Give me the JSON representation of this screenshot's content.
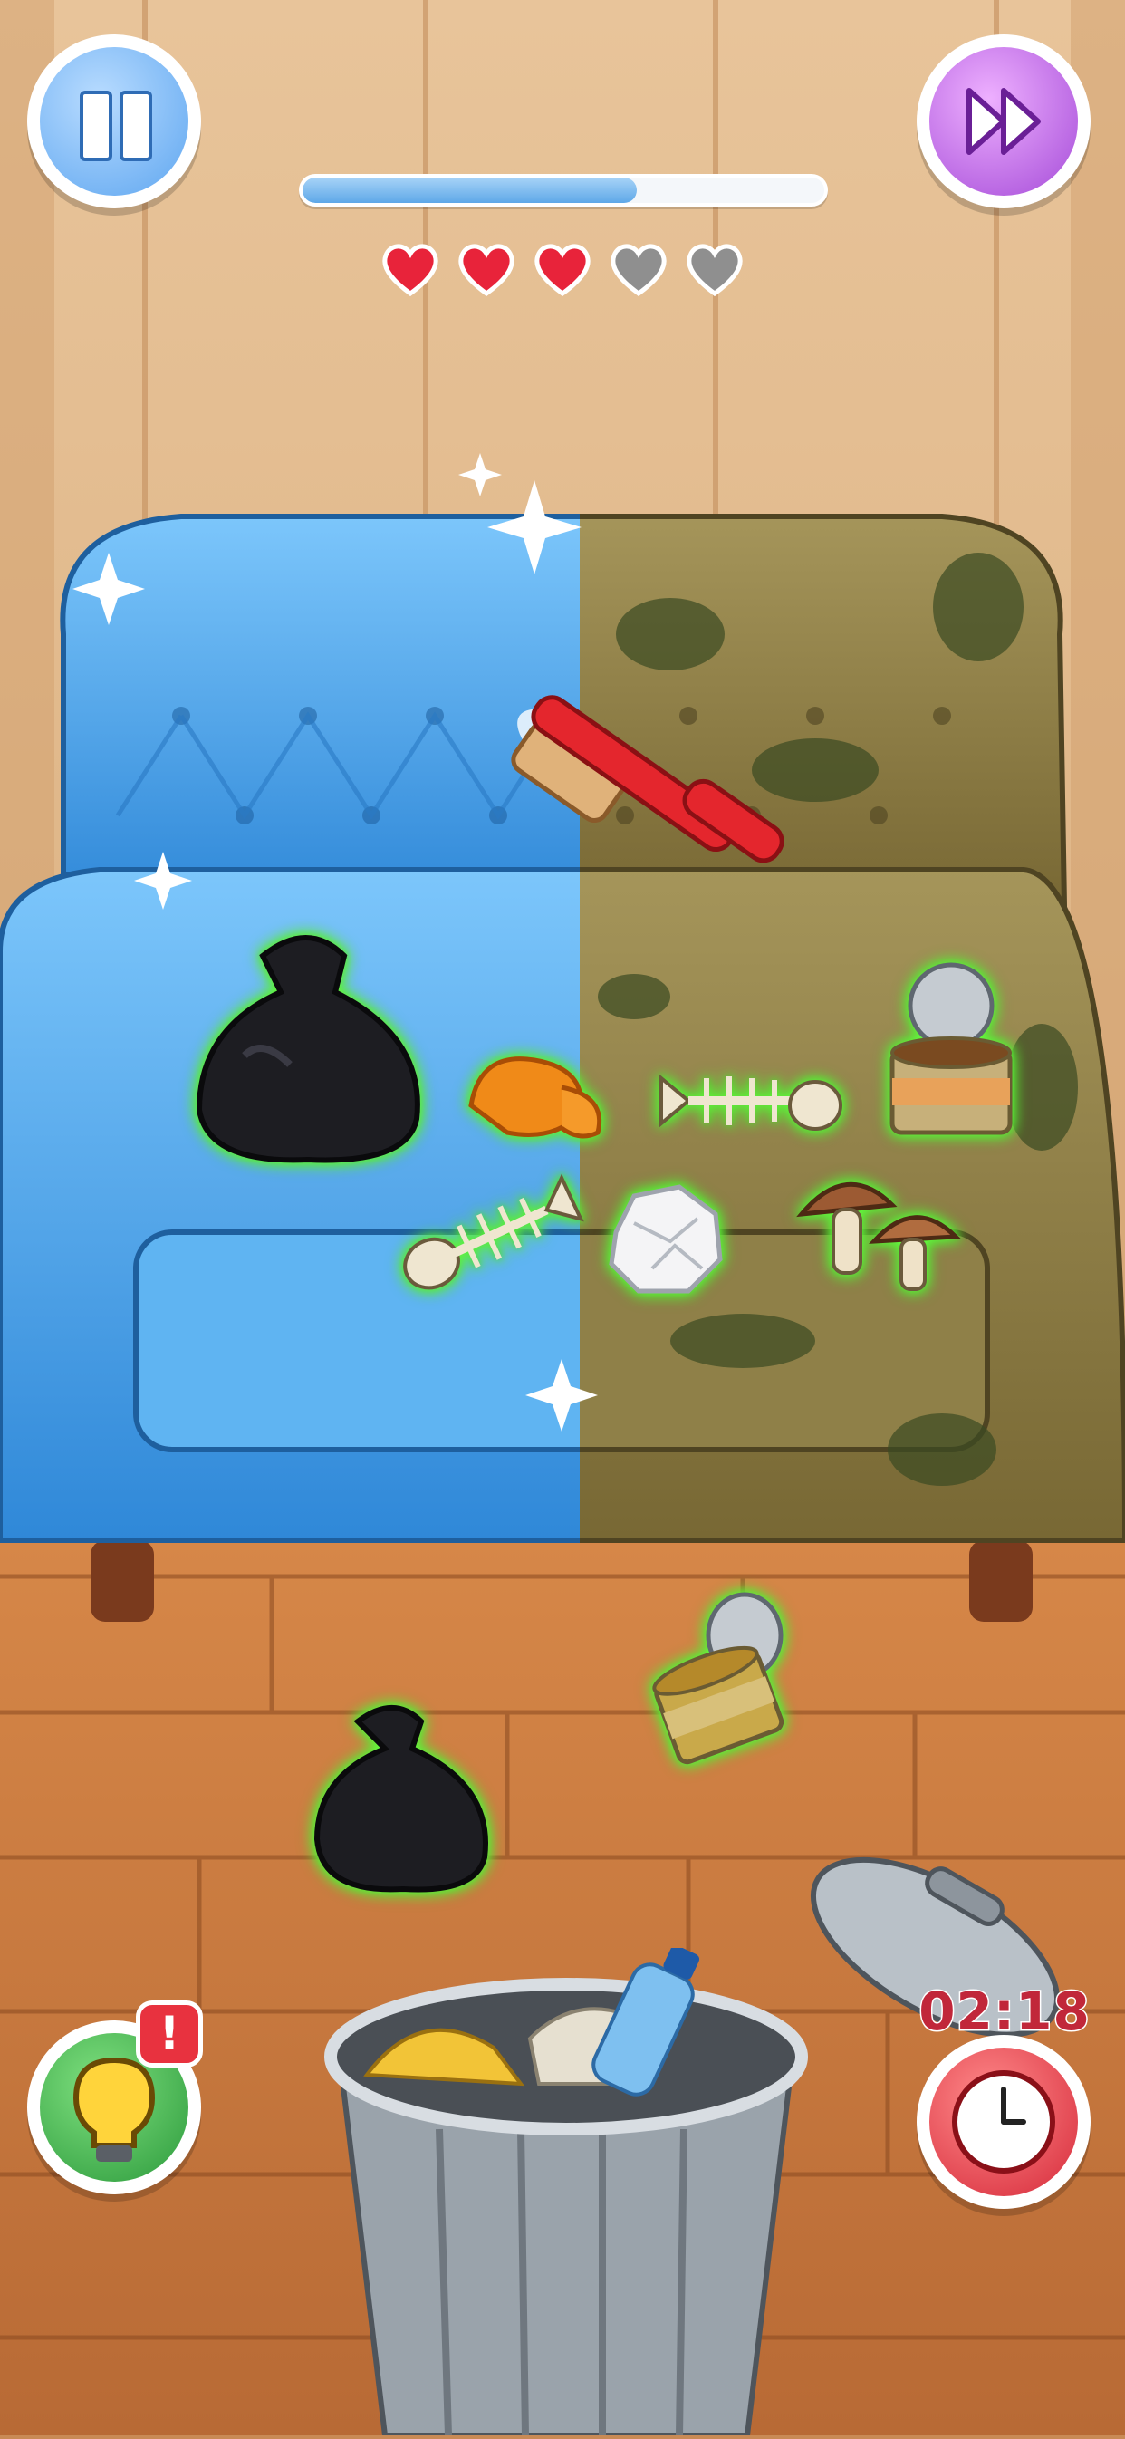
{
  "hud": {
    "pause_icon": "pause-icon",
    "skip_icon": "fast-forward-icon",
    "progress_fraction": 0.64,
    "hearts": [
      {
        "state": "full"
      },
      {
        "state": "full"
      },
      {
        "state": "full"
      },
      {
        "state": "empty"
      },
      {
        "state": "empty"
      }
    ],
    "hint_icon": "lightbulb-icon",
    "hint_badge": "!",
    "timer": "02:18",
    "timer_icon": "clock-icon"
  },
  "colors": {
    "heart_full": "#e8233a",
    "heart_empty": "#8f8f8f",
    "clean_sofa": "#4aa8ee",
    "dirty_sofa": "#8a7a3c",
    "item_glow": "#5dff3a",
    "timer_text": "#c1273a"
  },
  "items": [
    {
      "name": "garbage-bag"
    },
    {
      "name": "orange-peel"
    },
    {
      "name": "fish-bone"
    },
    {
      "name": "fish-bone"
    },
    {
      "name": "crumpled-paper"
    },
    {
      "name": "mushrooms"
    },
    {
      "name": "tin-can"
    },
    {
      "name": "tin-can"
    },
    {
      "name": "garbage-bag"
    }
  ],
  "tools": {
    "brush": "scrub-brush-icon"
  },
  "bin": {
    "icon": "trash-can-icon"
  }
}
